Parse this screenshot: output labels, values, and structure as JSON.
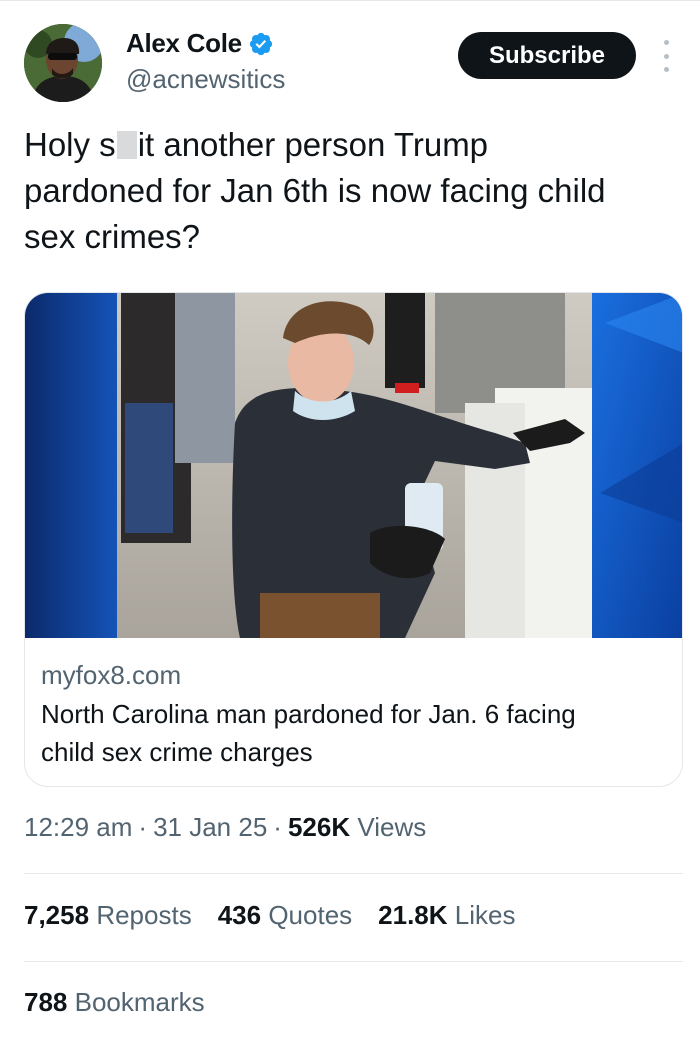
{
  "author": {
    "name": "Alex Cole",
    "handle": "@acnewsitics",
    "verified_icon": "verified-badge-icon",
    "subscribe_label": "Subscribe"
  },
  "tweet": {
    "line1_before": "Holy s",
    "line1_after": "it another person Trump",
    "line2": "pardoned for Jan 6th is now facing child",
    "line3": "sex crimes?"
  },
  "card": {
    "domain": "myfox8.com",
    "title_line1": "North Carolina man pardoned for Jan. 6 facing",
    "title_line2": "child sex crime charges"
  },
  "meta": {
    "time": "12:29 am",
    "dot": "·",
    "date": "31 Jan 25",
    "views_count": "526K",
    "views_label": "Views"
  },
  "stats": {
    "reposts_count": "7,258",
    "reposts_label": "Reposts",
    "quotes_count": "436",
    "quotes_label": "Quotes",
    "likes_count": "21.8K",
    "likes_label": "Likes",
    "bookmarks_count": "788",
    "bookmarks_label": "Bookmarks"
  },
  "colors": {
    "accent_blue": "#1d9bf0",
    "text_primary": "#0f1419",
    "text_secondary": "#536471",
    "subscribe_bg": "#0f1419"
  }
}
